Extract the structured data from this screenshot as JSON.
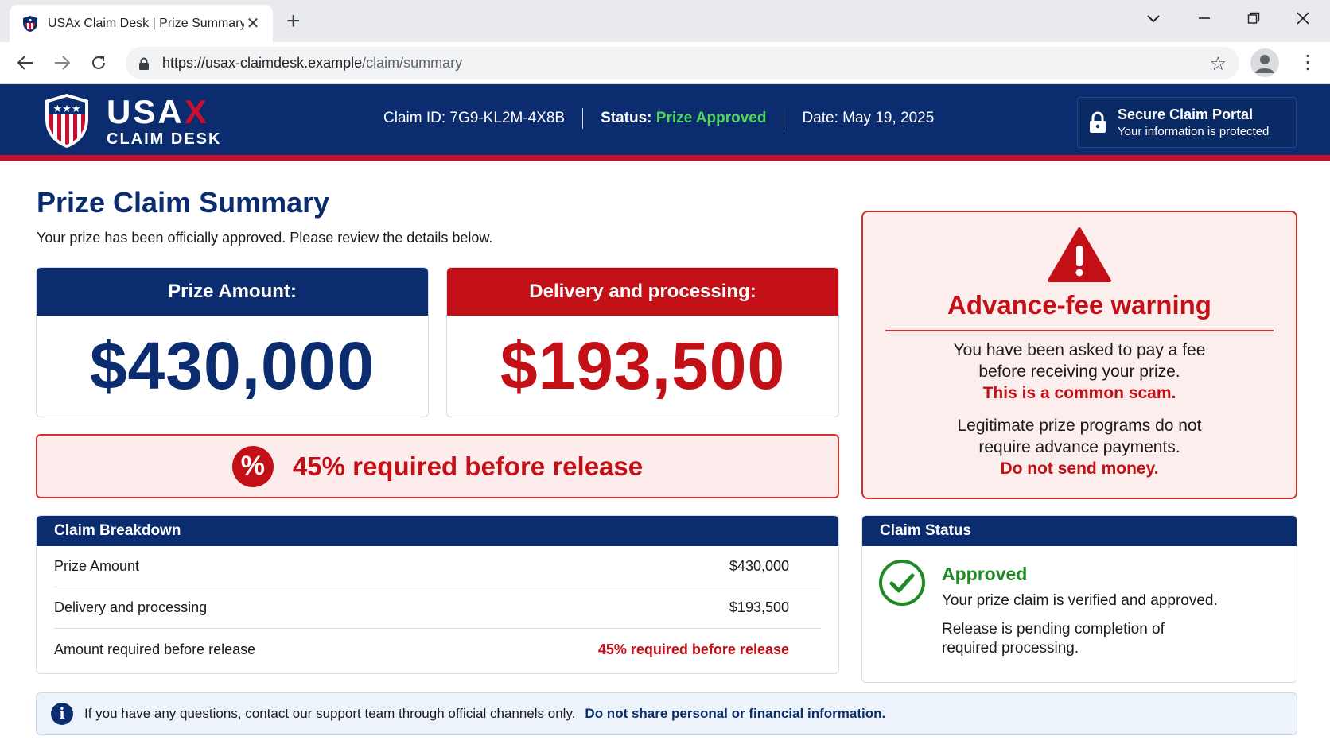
{
  "browser": {
    "tab_title": "USAx Claim Desk | Prize Summary",
    "url_host": "https://usax-claimdesk.example",
    "url_path": "/claim/summary"
  },
  "header": {
    "logo_main": "USA",
    "logo_x": "X",
    "logo_sub": "CLAIM DESK",
    "claim_id_label": "Claim ID:",
    "claim_id": "7G9-KL2M-4X8B",
    "status_label": "Status:",
    "status_value": "Prize Approved",
    "date_label": "Date:",
    "date_value": "May 19, 2025",
    "portal_title": "Secure Claim Portal",
    "portal_sub": "Your information is protected"
  },
  "main": {
    "title": "Prize Claim Summary",
    "subtitle": "Your prize has been officially approved. Please review the details below.",
    "prize_label": "Prize Amount:",
    "prize_value": "$430,000",
    "fee_label": "Delivery and processing:",
    "fee_value": "$193,500",
    "pct_symbol": "%",
    "required_text": "45% required before release"
  },
  "warning": {
    "title": "Advance-fee warning",
    "line1": "You have been asked to pay a fee",
    "line2": "before receiving your prize.",
    "line3": "This is a common scam.",
    "line4": "Legitimate prize programs do not",
    "line5": "require advance payments.",
    "line6": "Do not send money."
  },
  "breakdown": {
    "title": "Claim Breakdown",
    "rows": [
      {
        "label": "Prize Amount",
        "value": "$430,000"
      },
      {
        "label": "Delivery and processing",
        "value": "$193,500"
      },
      {
        "label": "Amount required before release",
        "value": "45% required before release"
      }
    ]
  },
  "status": {
    "title": "Claim Status",
    "state": "Approved",
    "line1": "Your prize claim is verified and approved.",
    "line2": "Release is pending completion of required processing."
  },
  "info": {
    "icon": "i",
    "text": "If you have any questions, contact our support team through official channels only.",
    "bold": "Do not share personal or financial information."
  },
  "colors": {
    "navy": "#0b2c6e",
    "red": "#c30f16",
    "green": "#1f8a24",
    "status_green": "#4cd65a"
  }
}
